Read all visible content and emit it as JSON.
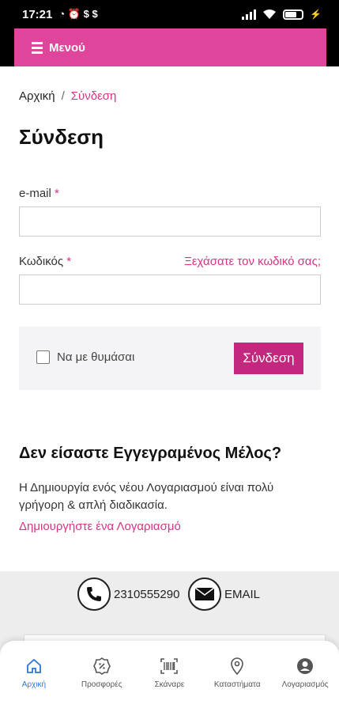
{
  "status_bar": {
    "time": "17:21",
    "left_icons": "◔ ⏰ $ $"
  },
  "menu": {
    "label": "Μενού"
  },
  "breadcrumb": {
    "home": "Αρχική",
    "separator": "/",
    "current": "Σύνδεση"
  },
  "page_title": "Σύνδεση",
  "form": {
    "email_label": "e-mail",
    "required_mark": "*",
    "email_value": "",
    "password_label": "Κωδικός",
    "password_value": "",
    "forgot_link": "Ξεχάσατε τον κωδικό σας;",
    "remember_label": "Να με θυμάσαι",
    "remember_checked": false,
    "submit_label": "Σύνδεση"
  },
  "register": {
    "title": "Δεν είσαστε Εγγεγραμένος Μέλος?",
    "description": "Η Δημιουργία ενός νέου Λογαριασμού είναι πολύ γρήγορη & απλή διαδικασία.",
    "link": "Δημιουργήστε ένα Λογαριασμό"
  },
  "footer": {
    "phone": "2310555290",
    "email": "EMAIL"
  },
  "bottom_nav": {
    "items": [
      {
        "label": "Αρχική",
        "icon": "home-icon"
      },
      {
        "label": "Προσφορές",
        "icon": "discount-badge-icon"
      },
      {
        "label": "Σκάναρε",
        "icon": "barcode-icon"
      },
      {
        "label": "Καταστήματα",
        "icon": "location-pin-icon"
      },
      {
        "label": "Λογαριασμός",
        "icon": "account-icon"
      }
    ],
    "active_index": 0
  },
  "colors": {
    "accent": "#e0459c",
    "button": "#c3287e",
    "link": "#d63384",
    "nav_active": "#2e76d2"
  }
}
